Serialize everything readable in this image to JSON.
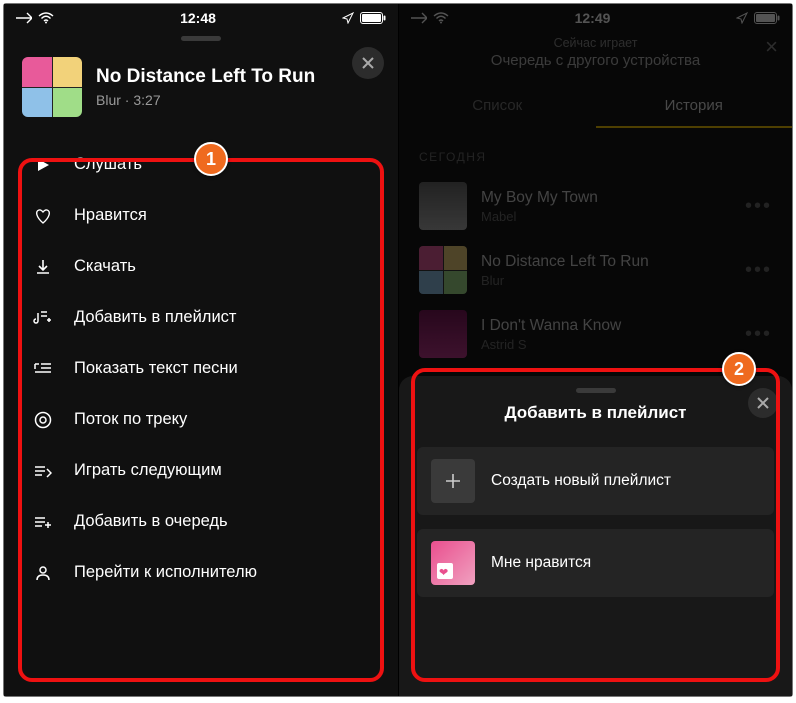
{
  "left": {
    "status": {
      "time": "12:48"
    },
    "track": {
      "title": "No Distance Left To Run",
      "artist": "Blur",
      "duration": "3:27"
    },
    "menu": [
      "Слушать",
      "Нравится",
      "Скачать",
      "Добавить в плейлист",
      "Показать текст песни",
      "Поток по треку",
      "Играть следующим",
      "Добавить в очередь",
      "Перейти к исполнителю"
    ]
  },
  "right": {
    "status": {
      "time": "12:49"
    },
    "header": {
      "small": "Сейчас играет",
      "big": "Очередь с другого устройства"
    },
    "tabs": {
      "list": "Список",
      "history": "История"
    },
    "section": "СЕГОДНЯ",
    "history": [
      {
        "title": "My Boy My Town",
        "artist": "Mabel"
      },
      {
        "title": "No Distance Left To Run",
        "artist": "Blur"
      },
      {
        "title": "I Don't Wanna Know",
        "artist": "Astrid S"
      }
    ],
    "sheet": {
      "title": "Добавить в плейлист",
      "create": "Создать новый плейлист",
      "liked": "Мне нравится"
    }
  },
  "annotations": {
    "one": "1",
    "two": "2"
  }
}
